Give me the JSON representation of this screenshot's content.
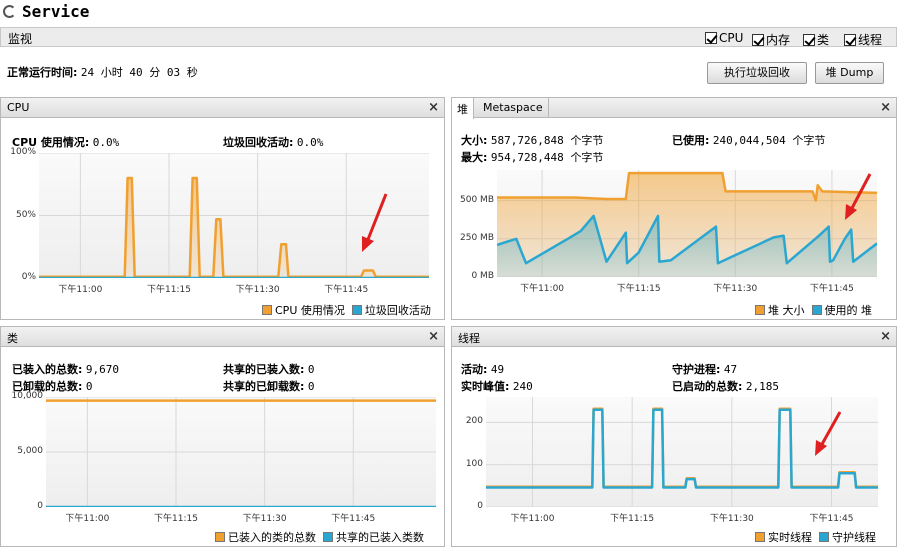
{
  "app": {
    "title": "Service"
  },
  "monitor": {
    "label": "监视",
    "checkboxes": [
      {
        "label": "CPU",
        "checked": true
      },
      {
        "label": "内存",
        "checked": true
      },
      {
        "label": "类",
        "checked": true
      },
      {
        "label": "线程",
        "checked": true
      }
    ]
  },
  "uptime": {
    "label": "正常运行时间:",
    "value": "24 小时 40 分 03 秒"
  },
  "buttons": {
    "gc": "执行垃圾回收",
    "heap_dump": "堆 Dump"
  },
  "colors": {
    "orange": "#f0a030",
    "blue": "#2aa7d0",
    "arrow": "#e02020"
  },
  "cpu_panel": {
    "title": "CPU",
    "close": "×",
    "stats": [
      {
        "label": "CPU 使用情况:",
        "value": "0.0%"
      },
      {
        "label": "垃圾回收活动:",
        "value": "0.0%"
      }
    ],
    "legend": [
      "CPU 使用情况",
      "垃圾回收活动"
    ]
  },
  "heap_panel": {
    "tabs": [
      "堆",
      "Metaspace"
    ],
    "close": "×",
    "stats": [
      {
        "label": "大小:",
        "value": "587,726,848 个字节"
      },
      {
        "label": "已使用:",
        "value": "240,044,504 个字节"
      },
      {
        "label": "最大:",
        "value": "954,728,448 个字节"
      }
    ],
    "legend": [
      "堆 大小",
      "使用的 堆"
    ]
  },
  "class_panel": {
    "title": "类",
    "close": "×",
    "stats": [
      {
        "label": "已装入的总数:",
        "value": "9,670"
      },
      {
        "label": "共享的已装入数:",
        "value": "0"
      },
      {
        "label": "已卸载的总数:",
        "value": "0"
      },
      {
        "label": "共享的已卸载数:",
        "value": "0"
      }
    ],
    "legend": [
      "已装入的类的总数",
      "共享的已装入类数"
    ]
  },
  "thread_panel": {
    "title": "线程",
    "close": "×",
    "stats": [
      {
        "label": "活动:",
        "value": "49"
      },
      {
        "label": "守护进程:",
        "value": "47"
      },
      {
        "label": "实时峰值:",
        "value": "240"
      },
      {
        "label": "已启动的总数:",
        "value": "2,185"
      }
    ],
    "legend": [
      "实时线程",
      "守护线程"
    ]
  },
  "chart_data": [
    {
      "type": "line",
      "panel": "cpu",
      "x_ticks": [
        "下午11:00",
        "下午11:15",
        "下午11:30",
        "下午11:45"
      ],
      "y_ticks": [
        "100%",
        "50%",
        "0%"
      ],
      "ylim": [
        0,
        100
      ],
      "xlim": [
        -7,
        59
      ],
      "series": [
        {
          "name": "CPU 使用情况",
          "color": "#f0a030",
          "area": true,
          "points": [
            [
              -7,
              1
            ],
            [
              7.5,
              1
            ],
            [
              8,
              80
            ],
            [
              8.7,
              80
            ],
            [
              9.2,
              1
            ],
            [
              18.5,
              1
            ],
            [
              19,
              80
            ],
            [
              19.7,
              80
            ],
            [
              20.2,
              1
            ],
            [
              22.5,
              1
            ],
            [
              23,
              47
            ],
            [
              23.7,
              47
            ],
            [
              24.2,
              1
            ],
            [
              33.5,
              1
            ],
            [
              34,
              27
            ],
            [
              34.8,
              27
            ],
            [
              35.2,
              1
            ],
            [
              47.5,
              1
            ],
            [
              48,
              6
            ],
            [
              49.5,
              6
            ],
            [
              50,
              1
            ],
            [
              59,
              1
            ]
          ]
        },
        {
          "name": "垃圾回收活动",
          "color": "#2aa7d0",
          "area": false,
          "points": [
            [
              -7,
              0
            ],
            [
              59,
              0
            ]
          ]
        }
      ]
    },
    {
      "type": "area",
      "panel": "heap",
      "x_ticks": [
        "下午11:00",
        "下午11:15",
        "下午11:30",
        "下午11:45"
      ],
      "y_ticks": [
        "500 MB",
        "250 MB",
        "0 MB"
      ],
      "ylim": [
        0,
        700
      ],
      "xlim": [
        -7,
        52
      ],
      "series": [
        {
          "name": "堆 大小",
          "color": "#f0a030",
          "points": [
            [
              -7,
              520
            ],
            [
              5,
              520
            ],
            [
              10,
              510
            ],
            [
              13,
              510
            ],
            [
              13.5,
              680
            ],
            [
              28,
              680
            ],
            [
              28.5,
              560
            ],
            [
              42,
              560
            ],
            [
              42.5,
              500
            ],
            [
              42.8,
              600
            ],
            [
              43.5,
              560
            ],
            [
              52,
              550
            ]
          ]
        },
        {
          "name": "使用的 堆",
          "color": "#2aa7d0",
          "points": [
            [
              -7,
              210
            ],
            [
              -4,
              250
            ],
            [
              -2.5,
              90
            ],
            [
              4,
              250
            ],
            [
              6,
              300
            ],
            [
              8,
              400
            ],
            [
              10,
              100
            ],
            [
              13,
              290
            ],
            [
              13.2,
              90
            ],
            [
              15,
              160
            ],
            [
              18,
              400
            ],
            [
              18.2,
              100
            ],
            [
              20,
              110
            ],
            [
              27,
              330
            ],
            [
              27.3,
              90
            ],
            [
              36,
              260
            ],
            [
              37.5,
              270
            ],
            [
              38,
              90
            ],
            [
              43,
              270
            ],
            [
              44.5,
              330
            ],
            [
              44.7,
              100
            ],
            [
              45.2,
              110
            ],
            [
              47,
              250
            ],
            [
              48,
              310
            ],
            [
              48.3,
              100
            ],
            [
              52,
              220
            ]
          ]
        }
      ]
    },
    {
      "type": "line",
      "panel": "class",
      "x_ticks": [
        "下午11:00",
        "下午11:15",
        "下午11:30",
        "下午11:45"
      ],
      "y_ticks": [
        "10,000",
        "5,000",
        "0"
      ],
      "ylim": [
        0,
        10000
      ],
      "xlim": [
        -7,
        59
      ],
      "series": [
        {
          "name": "已装入的类的总数",
          "color": "#f0a030",
          "points": [
            [
              -7,
              9670
            ],
            [
              59,
              9670
            ]
          ]
        },
        {
          "name": "共享的已装入类数",
          "color": "#2aa7d0",
          "points": [
            [
              -7,
              0
            ],
            [
              59,
              0
            ]
          ]
        }
      ]
    },
    {
      "type": "line",
      "panel": "thread",
      "x_ticks": [
        "下午11:00",
        "下午11:15",
        "下午11:30",
        "下午11:45"
      ],
      "y_ticks": [
        "200",
        "100",
        "0"
      ],
      "ylim": [
        0,
        260
      ],
      "xlim": [
        -7,
        52
      ],
      "series": [
        {
          "name": "实时线程",
          "color": "#f0a030",
          "points": [
            [
              -7,
              48
            ],
            [
              9,
              48
            ],
            [
              9.2,
              232
            ],
            [
              10.5,
              232
            ],
            [
              10.7,
              48
            ],
            [
              18,
              48
            ],
            [
              18.2,
              232
            ],
            [
              19.5,
              232
            ],
            [
              19.7,
              48
            ],
            [
              23,
              48
            ],
            [
              23.2,
              68
            ],
            [
              24.4,
              68
            ],
            [
              24.6,
              48
            ],
            [
              37,
              48
            ],
            [
              37.2,
              232
            ],
            [
              38.8,
              232
            ],
            [
              39,
              48
            ],
            [
              46,
              48
            ],
            [
              46.2,
              82
            ],
            [
              48.5,
              82
            ],
            [
              48.7,
              48
            ],
            [
              52,
              48
            ]
          ]
        },
        {
          "name": "守护线程",
          "color": "#2aa7d0",
          "points": [
            [
              -7,
              46
            ],
            [
              9,
              46
            ],
            [
              9.2,
              230
            ],
            [
              10.5,
              230
            ],
            [
              10.7,
              46
            ],
            [
              18,
              46
            ],
            [
              18.2,
              230
            ],
            [
              19.5,
              230
            ],
            [
              19.7,
              46
            ],
            [
              23,
              46
            ],
            [
              23.2,
              66
            ],
            [
              24.4,
              66
            ],
            [
              24.6,
              46
            ],
            [
              37,
              46
            ],
            [
              37.2,
              230
            ],
            [
              38.8,
              230
            ],
            [
              39,
              46
            ],
            [
              46,
              46
            ],
            [
              46.2,
              80
            ],
            [
              48.5,
              80
            ],
            [
              48.7,
              46
            ],
            [
              52,
              46
            ]
          ]
        }
      ]
    }
  ]
}
